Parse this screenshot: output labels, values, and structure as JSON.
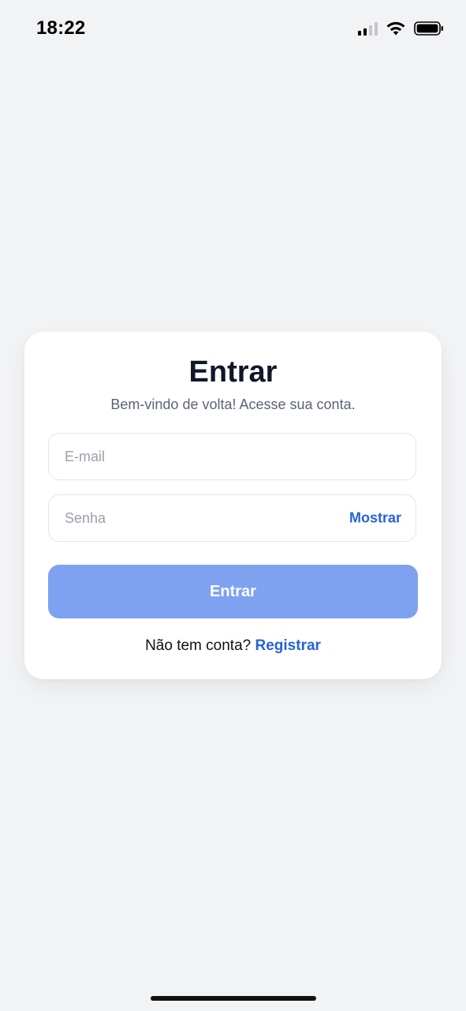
{
  "status_bar": {
    "time": "18:22",
    "icons": [
      "signal-icon",
      "wifi-icon",
      "battery-icon"
    ]
  },
  "login_card": {
    "title": "Entrar",
    "subtitle": "Bem-vindo de volta! Acesse sua conta.",
    "email": {
      "value": "",
      "placeholder": "E-mail"
    },
    "password": {
      "value": "",
      "placeholder": "Senha",
      "toggle_label": "Mostrar"
    },
    "submit_label": "Entrar",
    "signup_prompt": "Não tem conta?",
    "signup_link": "Registrar"
  },
  "colors": {
    "background": "#f2f3f5",
    "accent": "#2563d9",
    "button_disabled": "#7ea2f0",
    "title": "#0f172a"
  }
}
